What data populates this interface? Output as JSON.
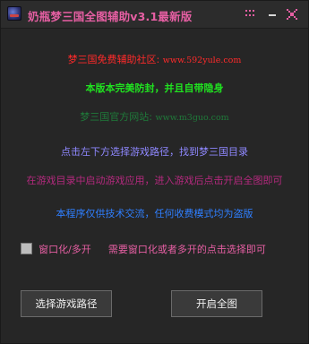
{
  "window": {
    "title": "奶瓶梦三国全图辅助v3.1最新版",
    "icons": {
      "app": "game-app-icon",
      "menu": "dots-menu-icon",
      "minimize": "minimize-icon",
      "close": "close-icon"
    }
  },
  "lines": {
    "community_label": "梦三国免费辅助社区:",
    "community_url": "www.592yule.com",
    "feature": "本版本完美防封，并且自带隐身",
    "official_label": "梦三国官方网站:",
    "official_url": "www.m3guo.com",
    "instruction1": "点击左下方选择游戏路径，找到梦三国目录",
    "instruction2": "在游戏目录中启动游戏应用，进入游戏后点击开启全图即可",
    "disclaimer": "本程序仅供技术交流，任何收费模式均为盗版"
  },
  "options": {
    "window_mode_label": "窗口化/多开",
    "window_mode_checked": false,
    "window_mode_hint": "需要窗口化或者多开的点击选择即可"
  },
  "buttons": {
    "select_path": "选择游戏路径",
    "enable_map": "开启全图"
  },
  "colors": {
    "background": "#262626",
    "title": "#e65fa3",
    "community": "#ff2a2a",
    "feature": "#20e020",
    "official": "#1f7a3a",
    "instruction1": "#8f88ff",
    "instruction2": "#b4297e",
    "disclaimer": "#2f7fff"
  }
}
